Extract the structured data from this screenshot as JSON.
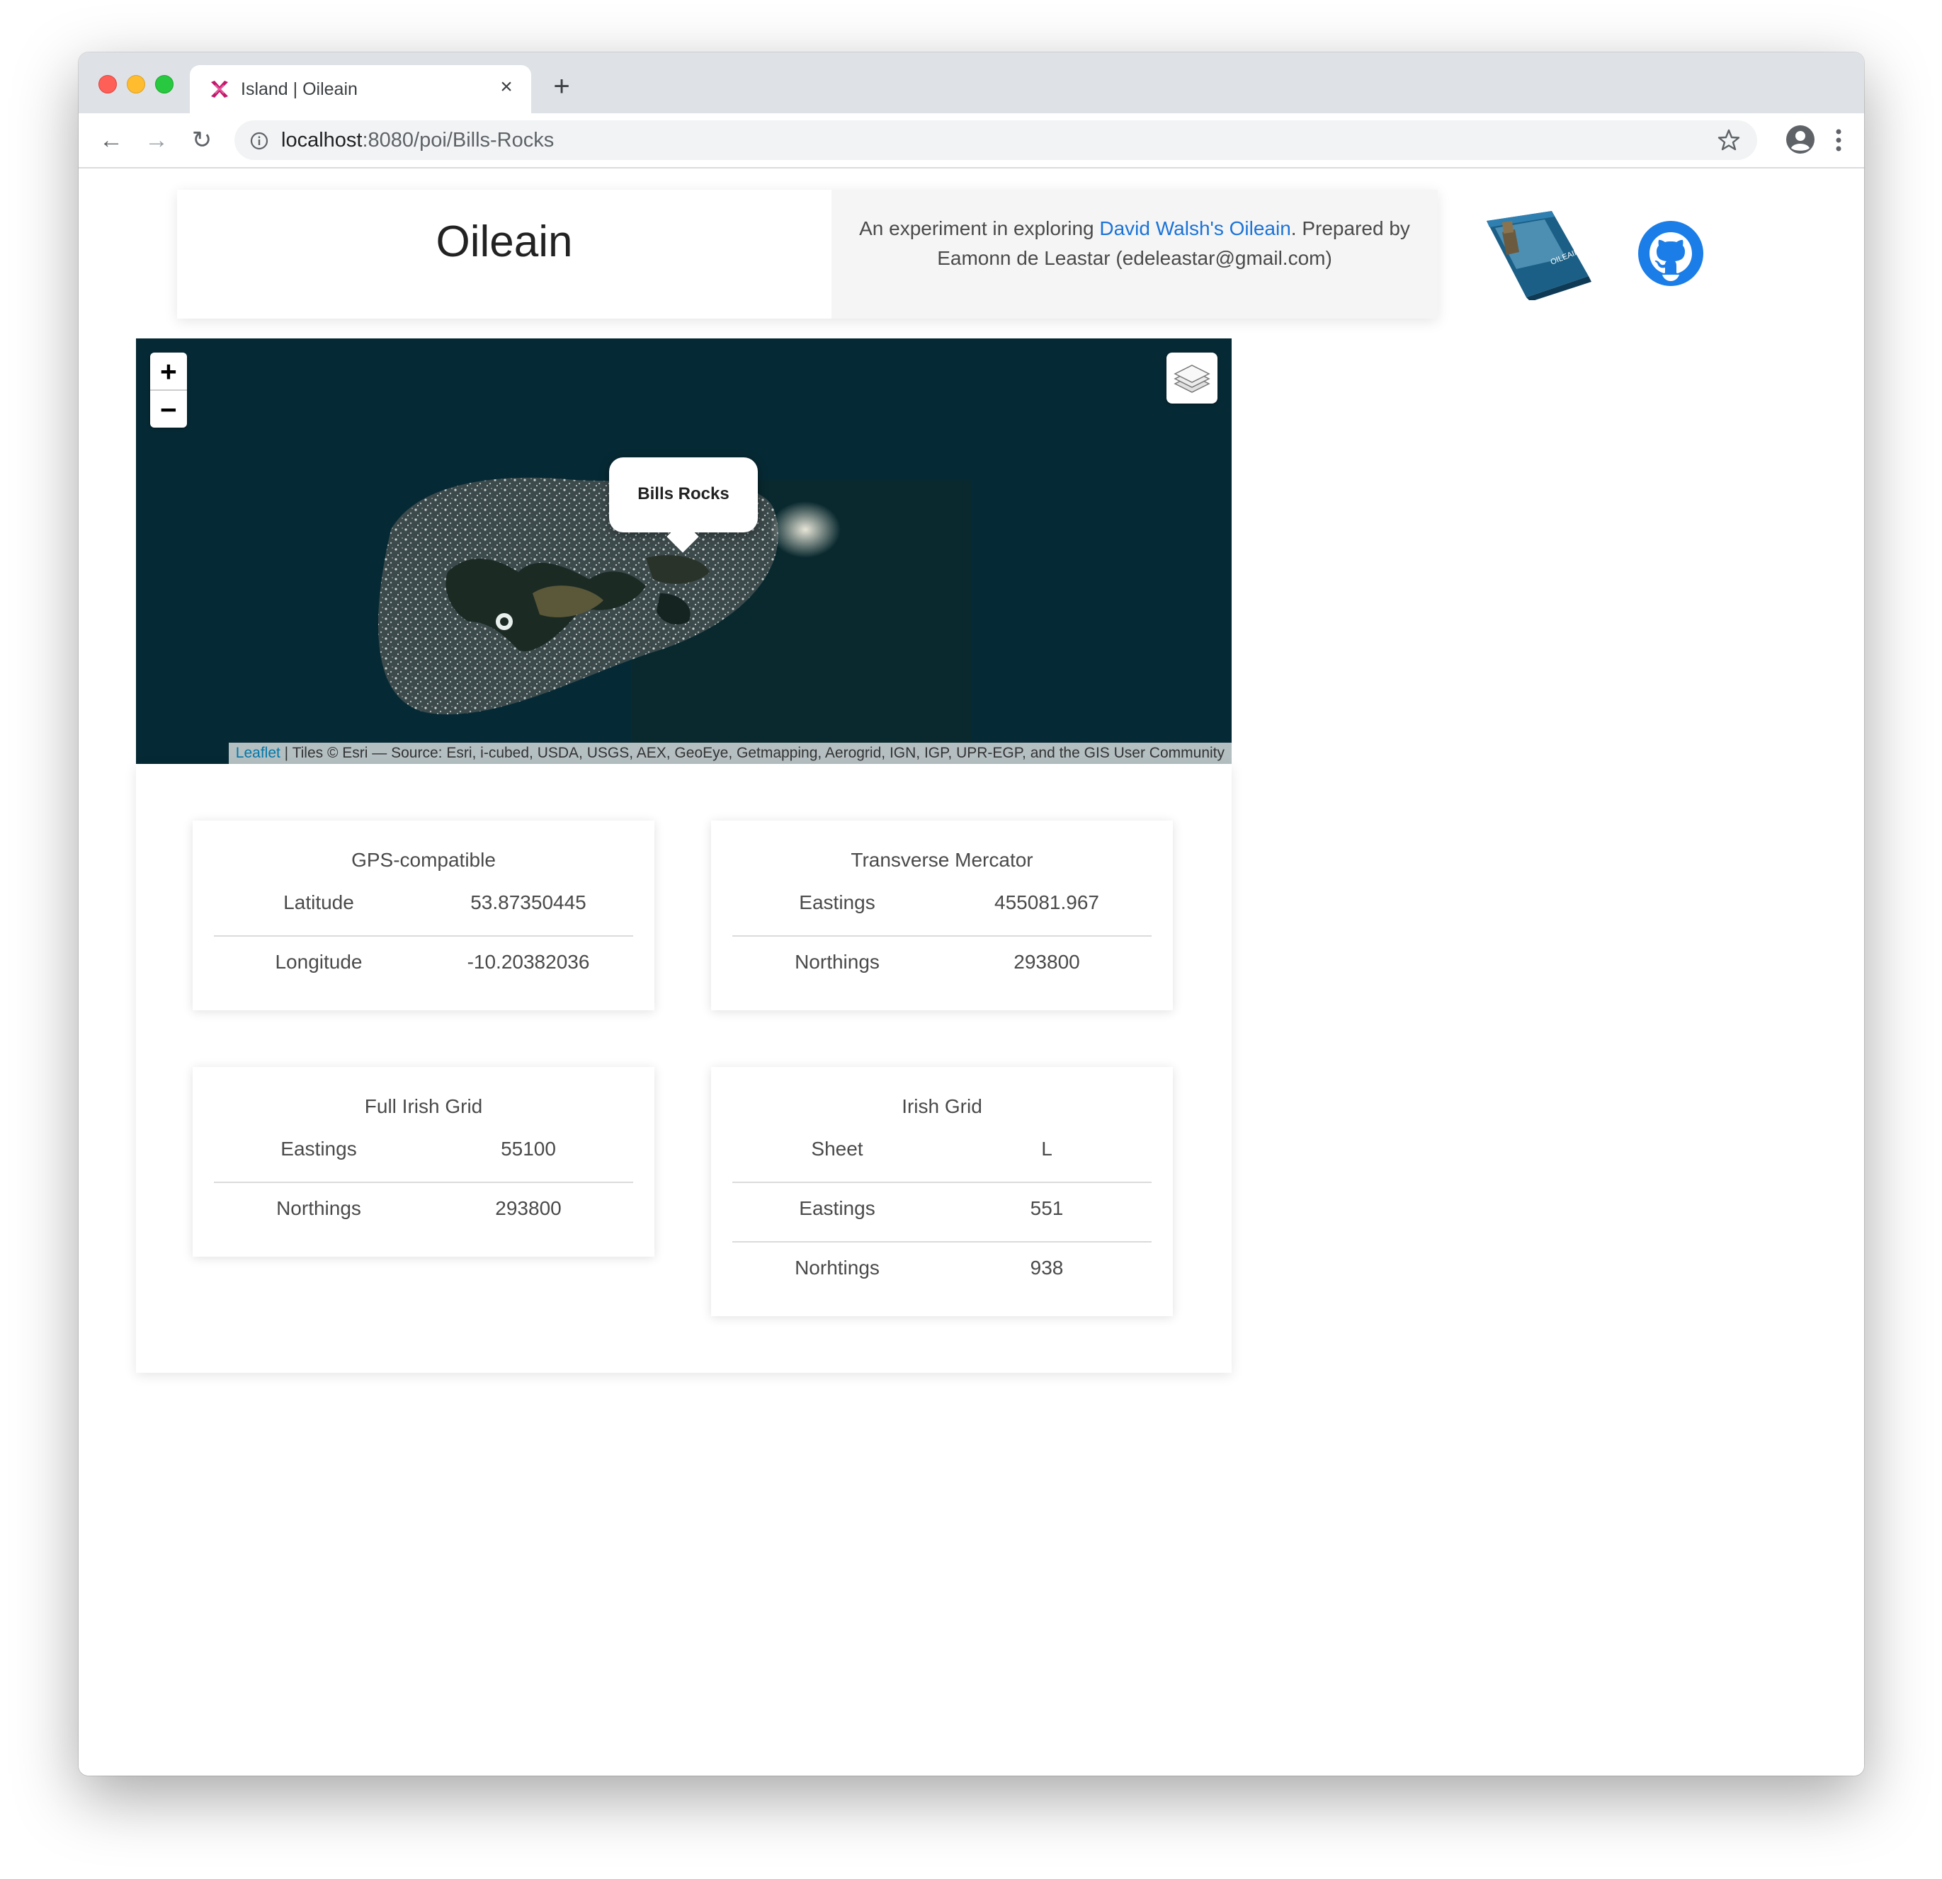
{
  "browser": {
    "tab_title": "Island | Oileain",
    "tab_close": "×",
    "new_tab": "+",
    "url_host": "localhost",
    "url_path": ":8080/poi/Bills-Rocks",
    "nav_back": "←",
    "nav_forward": "→",
    "nav_reload": "↻"
  },
  "header": {
    "title": "Oileain",
    "description_before": "An experiment in exploring ",
    "description_link": "David Walsh's Oileain",
    "description_after": ". Prepared by Eamonn de Leastar (edeleastar@gmail.com)",
    "book_cover_text": "OILEAIN"
  },
  "map": {
    "zoom_in": "+",
    "zoom_out": "−",
    "popup": "Bills Rocks",
    "attribution_link": "Leaflet",
    "attribution_text": " | Tiles © Esri — Source: Esri, i-cubed, USDA, USGS, AEX, GeoEye, Getmapping, Aerogrid, IGN, IGP, UPR-EGP, and the GIS User Community"
  },
  "cards": {
    "gps": {
      "title": "GPS-compatible",
      "rows": [
        {
          "label": "Latitude",
          "value": "53.87350445"
        },
        {
          "label": "Longitude",
          "value": "-10.20382036"
        }
      ]
    },
    "mercator": {
      "title": "Transverse Mercator",
      "rows": [
        {
          "label": "Eastings",
          "value": "455081.967"
        },
        {
          "label": "Northings",
          "value": "293800"
        }
      ]
    },
    "full_irish": {
      "title": "Full Irish Grid",
      "rows": [
        {
          "label": "Eastings",
          "value": "55100"
        },
        {
          "label": "Northings",
          "value": "293800"
        }
      ]
    },
    "irish": {
      "title": "Irish Grid",
      "rows": [
        {
          "label": "Sheet",
          "value": "L"
        },
        {
          "label": "Eastings",
          "value": "551"
        },
        {
          "label": "Norhtings",
          "value": "938"
        }
      ]
    }
  },
  "colors": {
    "link": "#1a73d8",
    "map_sea": "#062a35",
    "github": "#1a7de8"
  }
}
